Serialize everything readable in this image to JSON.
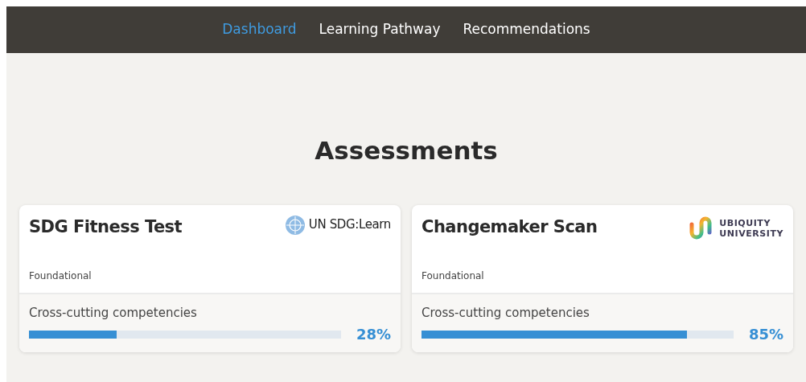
{
  "nav": [
    {
      "label": "Dashboard",
      "selected": true
    },
    {
      "label": "Learning Pathway",
      "selected": false
    },
    {
      "label": "Recommendations",
      "selected": false
    }
  ],
  "heading": "Assessments",
  "cards": [
    {
      "title": "SDG Fitness Test",
      "logo": {
        "kind": "un",
        "lines": [
          "UN SDG:Learn"
        ]
      },
      "level_label": "Foundational",
      "metric": {
        "label": "Cross-cutting competencies",
        "level": 0.28,
        "reading": "28%"
      }
    },
    {
      "title": "Changemaker Scan",
      "logo": {
        "kind": "ubiquity",
        "lines": [
          "UBIQUITY",
          "UNIVERSITY"
        ]
      },
      "level_label": "Foundational",
      "metric": {
        "label": "Cross-cutting competencies",
        "level": 0.85,
        "reading": "85%"
      }
    }
  ]
}
